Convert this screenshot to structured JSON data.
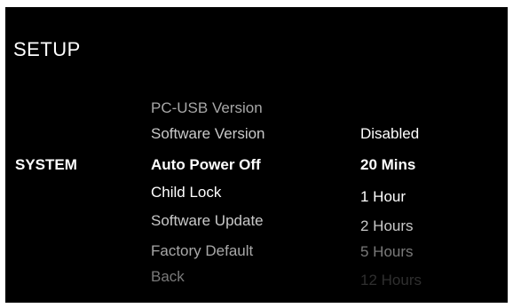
{
  "screen": {
    "title": "SETUP",
    "category": "SYSTEM"
  },
  "menu": {
    "items": [
      {
        "label": "PC-USB Version"
      },
      {
        "label": "Software Version"
      },
      {
        "label": "Auto Power Off"
      },
      {
        "label": "Child Lock"
      },
      {
        "label": "Software Update"
      },
      {
        "label": "Factory Default"
      },
      {
        "label": "Back"
      }
    ]
  },
  "options": {
    "items": [
      {
        "label": "Disabled"
      },
      {
        "label": "20 Mins"
      },
      {
        "label": "1 Hour"
      },
      {
        "label": "2 Hours"
      },
      {
        "label": "5 Hours"
      },
      {
        "label": "12 Hours"
      }
    ]
  }
}
